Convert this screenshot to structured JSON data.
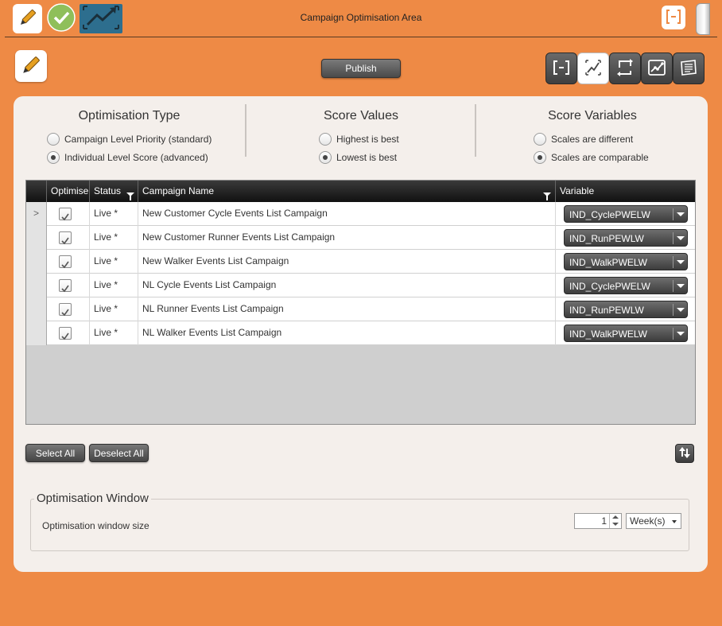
{
  "app": {
    "title": "Campaign Optimisation Area"
  },
  "toolbar": {
    "top_icons": [
      "pencil-icon",
      "checkmark-icon",
      "trend-chart-icon"
    ],
    "publish_label": "Publish",
    "view_icons": [
      "bracket-icon",
      "trend-icon",
      "loop-icon",
      "chart-points-icon",
      "list-icon"
    ]
  },
  "options": {
    "optimisation_type": {
      "title": "Optimisation Type",
      "options": [
        "Campaign Level Priority (standard)",
        "Individual Level Score (advanced)"
      ],
      "selected": "Individual Level Score (advanced)"
    },
    "score_values": {
      "title": "Score Values",
      "options": [
        "Highest is best",
        "Lowest is best"
      ],
      "selected": "Lowest is best"
    },
    "score_variables": {
      "title": "Score Variables",
      "options": [
        "Scales are different",
        "Scales are comparable"
      ],
      "selected": "Scales are comparable"
    }
  },
  "grid": {
    "columns": [
      "Optimise",
      "Status",
      "Campaign Name",
      "Variable"
    ],
    "rows": [
      {
        "optimise": true,
        "status": "Live *",
        "name": "New Customer Cycle Events List Campaign",
        "variable": "IND_CyclePWELW"
      },
      {
        "optimise": true,
        "status": "Live *",
        "name": "New Customer Runner Events List Campaign",
        "variable": "IND_RunPEWLW"
      },
      {
        "optimise": true,
        "status": "Live *",
        "name": "New Walker Events List Campaign",
        "variable": "IND_WalkPWELW"
      },
      {
        "optimise": true,
        "status": "Live *",
        "name": "NL Cycle Events List Campaign",
        "variable": "IND_CyclePWELW"
      },
      {
        "optimise": true,
        "status": "Live *",
        "name": "NL Runner Events List Campaign",
        "variable": "IND_RunPEWLW"
      },
      {
        "optimise": true,
        "status": "Live *",
        "name": "NL Walker Events List Campaign",
        "variable": "IND_WalkPWELW"
      }
    ],
    "current_row_marker": ">"
  },
  "grid_actions": {
    "select_all": "Select All",
    "deselect_all": "Deselect All"
  },
  "window": {
    "title": "Optimisation Window",
    "size_label": "Optimisation window size",
    "size_value": "1",
    "unit": "Week(s)"
  },
  "colors": {
    "background": "#ee8a45",
    "panel": "#f4efeb",
    "accent_icon": "#2d6e8e"
  }
}
